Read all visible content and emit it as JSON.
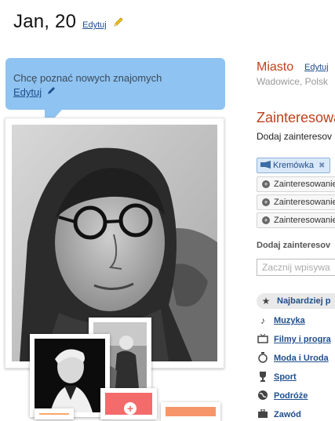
{
  "header": {
    "name": "Jan, 20",
    "edit_label": "Edytuj"
  },
  "status": {
    "text": "Chcę poznać nowych znajomych",
    "edit_label": "Edytuj"
  },
  "city": {
    "title": "Miasto",
    "edit_label": "Edytuj",
    "value": "Wadowice, Polsk"
  },
  "interests": {
    "title": "Zainteresowa",
    "add_prompt": "Dodaj zainteresov",
    "selected": [
      {
        "label": "Kremówka"
      }
    ],
    "suggestions": [
      {
        "label": "Zainteresowanie"
      },
      {
        "label": "Zainteresowanie"
      },
      {
        "label": "Zainteresowanie"
      }
    ],
    "add_label": "Dodaj zainteresov",
    "search_placeholder": "Zacznij wpisywa"
  },
  "categories": [
    {
      "label": "Najbardziej p",
      "icon": "star-icon",
      "active": true
    },
    {
      "label": "Muzyka",
      "icon": "music-note-icon"
    },
    {
      "label": "Filmy i progra",
      "icon": "tv-icon"
    },
    {
      "label": "Moda i Uroda",
      "icon": "stopwatch-icon"
    },
    {
      "label": "Sport",
      "icon": "trophy-icon"
    },
    {
      "label": "Podróże",
      "icon": "globe-icon"
    },
    {
      "label": "Zawód",
      "icon": "briefcase-icon"
    }
  ],
  "colors": {
    "accent_title": "#c0411a",
    "link": "#1f4e8c",
    "bubble": "#8fc3f1",
    "tag_selected_bg": "#d9e8f8"
  }
}
